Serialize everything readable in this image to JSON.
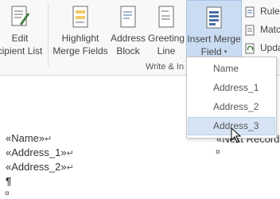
{
  "ribbon": {
    "edit_recipient_list": {
      "line1": "Edit",
      "line2": "cipient List"
    },
    "highlight_merge_fields": {
      "line1": "Highlight",
      "line2": "Merge Fields"
    },
    "address_block": {
      "line1": "Address",
      "line2": "Block"
    },
    "greeting_line": {
      "line1": "Greeting",
      "line2": "Line"
    },
    "insert_merge_field": {
      "line1": "Insert Merge",
      "line2": "Field",
      "chevron": "▾"
    },
    "group_label": "Write & In",
    "small_buttons": [
      {
        "label": "Rules"
      },
      {
        "label": "Matc"
      },
      {
        "label": "Upda"
      }
    ]
  },
  "dropdown": {
    "items": [
      {
        "label": "Name"
      },
      {
        "label": "Address_1"
      },
      {
        "label": "Address_2"
      },
      {
        "label": "Address_3"
      }
    ],
    "hovered_index": 3
  },
  "document": {
    "lines": [
      {
        "text": "«Name»",
        "mark": "↵"
      },
      {
        "text": "«Address_1»",
        "mark": "↵"
      },
      {
        "text": "«Address_2»",
        "mark": "↵"
      }
    ],
    "pilcrow": "¶",
    "cell_mark": "¤",
    "next_record": "«Next Record»"
  },
  "colors": {
    "ribbon_bg": "#f8f8f8",
    "active_button": "#c9dcf2",
    "hover_item": "#d6e4f5"
  }
}
